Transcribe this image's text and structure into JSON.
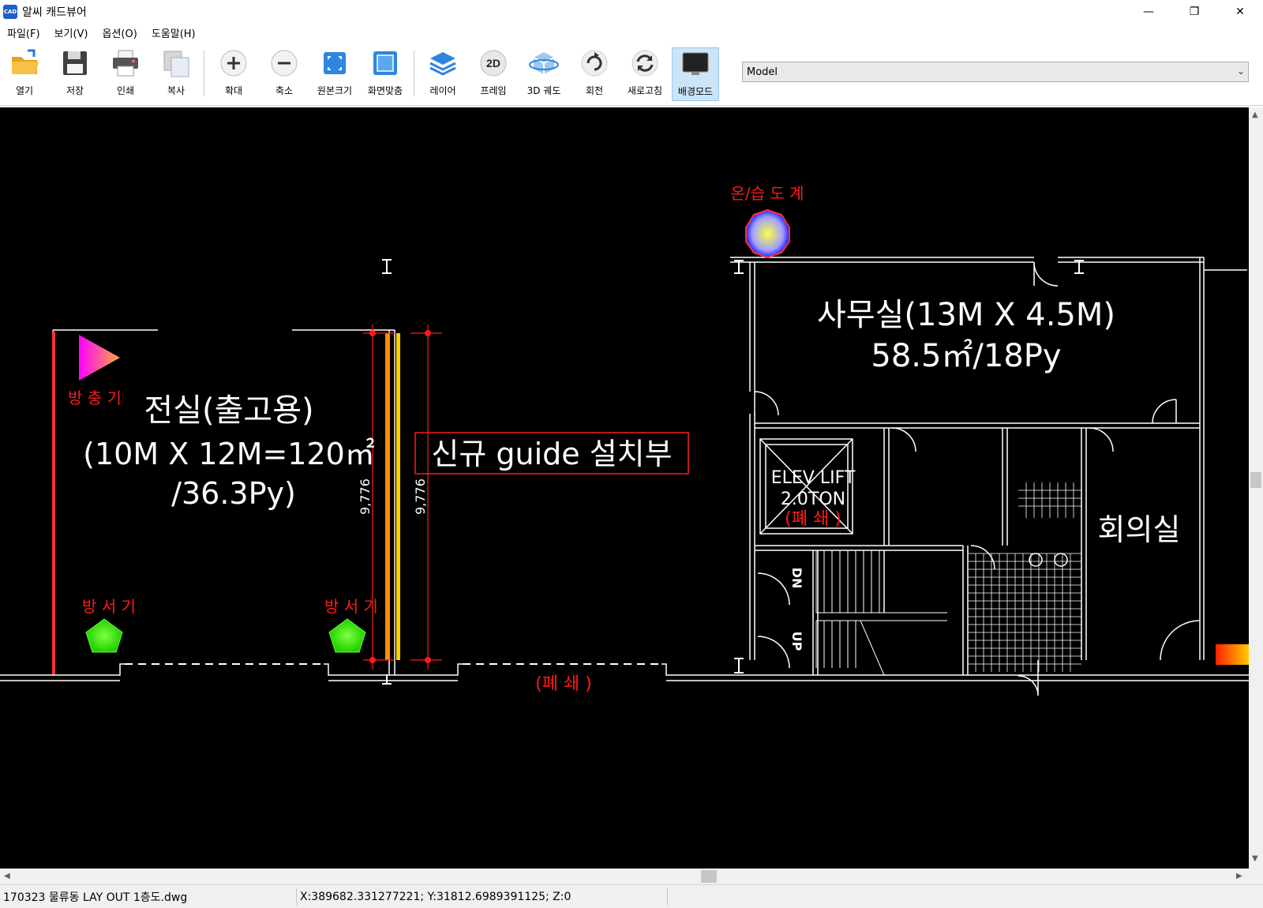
{
  "window": {
    "title": "알씨 캐드뷰어",
    "app_icon_text": "CAD",
    "minimize": "—",
    "restore": "❐",
    "close": "✕"
  },
  "menu": [
    "파일(F)",
    "보기(V)",
    "옵션(O)",
    "도움말(H)"
  ],
  "toolbar": {
    "open": "열기",
    "save": "저장",
    "print": "인쇄",
    "copy": "복사",
    "zoom_in": "확대",
    "zoom_out": "축소",
    "original_size": "원본크기",
    "fit_screen": "화면맞춤",
    "layer": "레이어",
    "frame": "프레임",
    "orbit_3d": "3D 궤도",
    "rotate": "회전",
    "refresh": "새로고침",
    "background_mode": "배경모드",
    "frame_icon_text": "2D"
  },
  "layout_select": {
    "value": "Model"
  },
  "drawing": {
    "labels": {
      "thermo_hygrometer": "온/습 도 계",
      "insect_repeller": "방 충 기",
      "storage_room_title": "전실(출고용)",
      "storage_room_dims": "(10M X 12M=120㎡",
      "storage_room_area": "/36.3Py)",
      "guide_install": "신규 guide 설치부",
      "dim_left": "9,776",
      "dim_right": "9,776",
      "heater_left": "방 서 기",
      "heater_right": "방 서 기",
      "closed_bottom": "(폐 쇄 )",
      "office_title": "사무실(13M X 4.5M)",
      "office_area": "58.5㎡/18Py",
      "elev_line1": "ELEV LIFT",
      "elev_line2": "2.0TON",
      "elev_closed": "(폐 쇄 )",
      "meeting_room": "회의실",
      "stair_dn": "DN",
      "stair_up": "UP"
    },
    "colors": {
      "background": "#000000",
      "walls": "#ffffff",
      "annotation": "#ff1a1a",
      "guide_rail": "#ff9900",
      "thermo_fill": "#fff000",
      "thermo_edge": "#2020ff",
      "heater_fill": "#3cff00",
      "repeller_fill": "#ff33cc"
    }
  },
  "status": {
    "file": "170323 물류동 LAY OUT 1층도.dwg",
    "coords": "X:389682.331277221; Y:31812.6989391125; Z:0"
  }
}
